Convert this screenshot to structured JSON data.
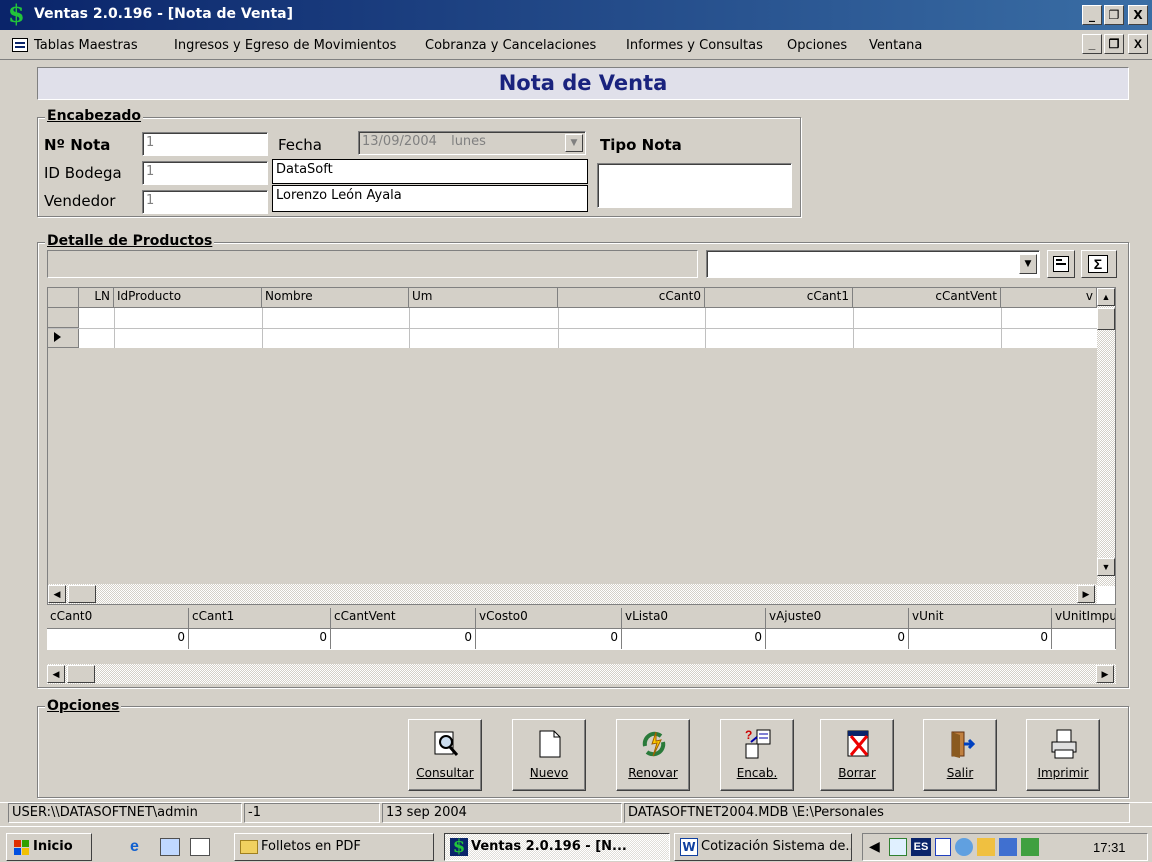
{
  "window": {
    "title": "Ventas 2.0.196 - [Nota de Venta]",
    "min": "_",
    "max": "❐",
    "close": "X"
  },
  "menu": [
    "Tablas Maestras",
    "Ingresos y Egreso de Movimientos",
    "Cobranza y Cancelaciones",
    "Informes y Consultas",
    "Opciones",
    "Ventana"
  ],
  "form_title": "Nota de Venta",
  "encabezado": {
    "label": "Encabezado",
    "nota_label": "Nº Nota",
    "nota_value": "1",
    "bodega_label": "ID Bodega",
    "bodega_value": "1",
    "vendedor_label": "Vendedor",
    "vendedor_value": "1",
    "fecha_label": "Fecha",
    "fecha_value": "13/09/2004",
    "fecha_day": "lunes",
    "bodega_name": "DataSoft",
    "vendedor_name": "Lorenzo León Ayala",
    "tipo_label": "Tipo Nota",
    "tipo_value": ""
  },
  "detalle": {
    "label": "Detalle de Productos",
    "columns": [
      "LN",
      "IdProducto",
      "Nombre",
      "Um",
      "cCant0",
      "cCant1",
      "cCantVent",
      "v"
    ],
    "totals_columns": [
      "cCant0",
      "cCant1",
      "cCantVent",
      "vCosto0",
      "vLista0",
      "vAjuste0",
      "vUnit",
      "vUnitImpu"
    ],
    "totals_values": [
      "0",
      "0",
      "0",
      "0",
      "0",
      "0",
      "0",
      ""
    ]
  },
  "opciones": {
    "label": "Opciones",
    "buttons": [
      {
        "name": "consultar",
        "label": "Consultar",
        "icon": "magnifier-icon"
      },
      {
        "name": "nuevo",
        "label": "Nuevo",
        "icon": "new-page-icon"
      },
      {
        "name": "renovar",
        "label": "Renovar",
        "icon": "refresh-icon"
      },
      {
        "name": "encab",
        "label": "Encab.",
        "icon": "header-icon"
      },
      {
        "name": "borrar",
        "label": "Borrar",
        "icon": "delete-icon"
      },
      {
        "name": "salir",
        "label": "Salir",
        "icon": "exit-door-icon"
      },
      {
        "name": "imprimir",
        "label": "Imprimir",
        "icon": "printer-icon"
      }
    ]
  },
  "status": {
    "user": "USER:\\\\DATASOFTNET\\admin",
    "num": "-1",
    "date": "13 sep 2004",
    "db": "DATASOFTNET2004.MDB \\E:\\Personales"
  },
  "taskbar": {
    "start": "Inicio",
    "items": [
      "Folletos en PDF",
      "Ventas 2.0.196 - [N...",
      "Cotización Sistema de..."
    ],
    "clock": "17:31",
    "lang": "ES"
  },
  "colors": {
    "title_gradient_start": "#0a246a",
    "title_gradient_end": "#3a6ea5",
    "form_title": "#1a237e",
    "face": "#d4d0c8"
  }
}
